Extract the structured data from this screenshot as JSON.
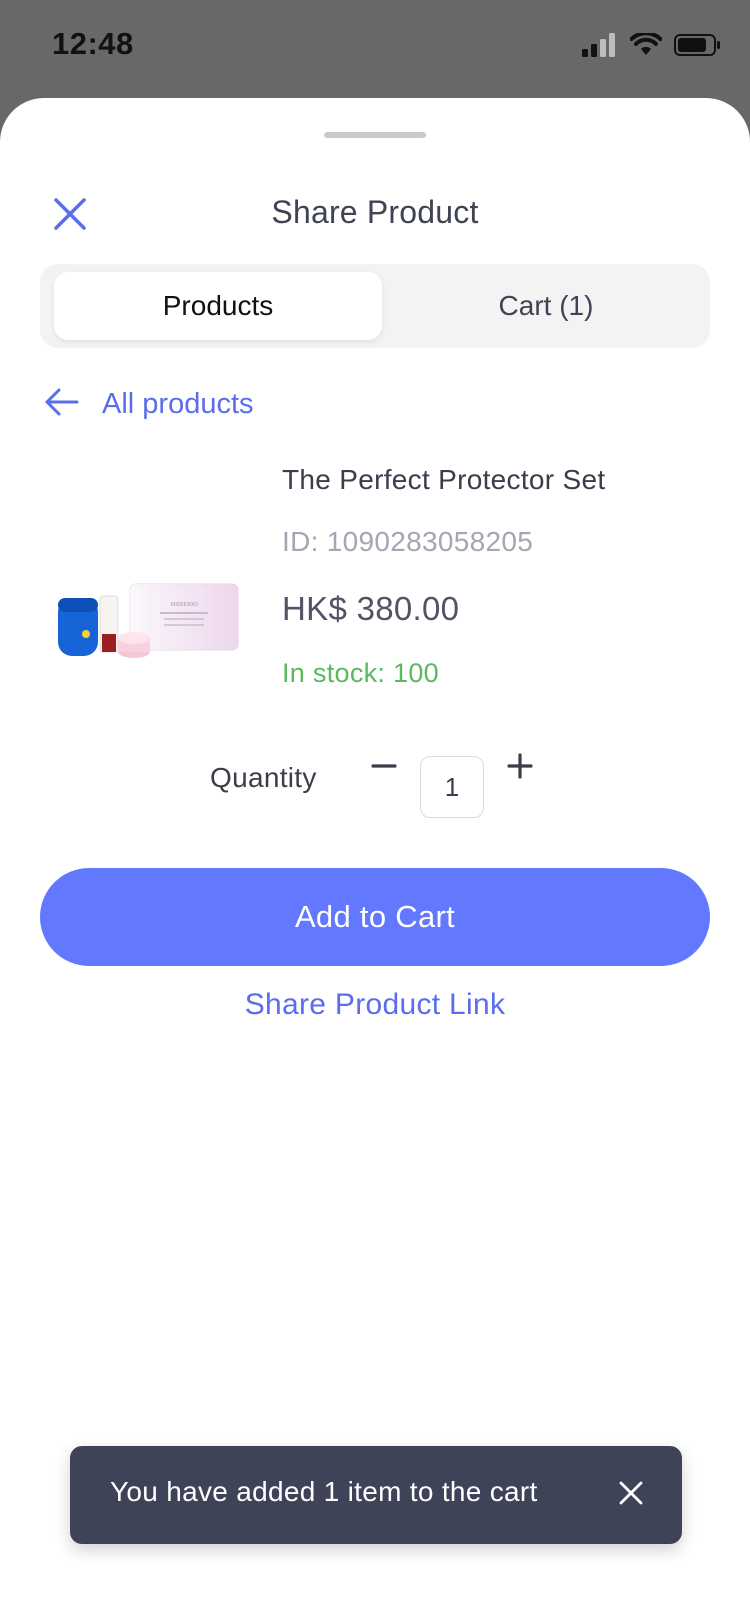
{
  "status_bar": {
    "time": "12:48",
    "icons": [
      "signal-icon",
      "wifi-icon",
      "battery-icon"
    ]
  },
  "sheet": {
    "title": "Share Product",
    "close_icon": "close-icon"
  },
  "segmented_control": {
    "tabs": [
      {
        "label": "Products",
        "active": true
      },
      {
        "label": "Cart (1)",
        "active": false
      }
    ]
  },
  "back_link": {
    "icon": "arrow-left-icon",
    "label": "All products"
  },
  "product": {
    "name": "The Perfect Protector Set",
    "id": "ID: 1090283058205",
    "price": "HK$ 380.00",
    "stock": "In stock: 100",
    "image_brand_text": "SHISEIDO"
  },
  "quantity": {
    "label": "Quantity",
    "value": "1"
  },
  "actions": {
    "add_to_cart_label": "Add to Cart",
    "share_link_label": "Share Product Link"
  },
  "toast": {
    "message": "You have added 1 item to the cart"
  },
  "colors": {
    "accent": "#6279ff",
    "link": "#5a6dec",
    "stock_green": "#5cb85c",
    "toast_bg": "#3f4358",
    "backdrop": "#686868"
  }
}
